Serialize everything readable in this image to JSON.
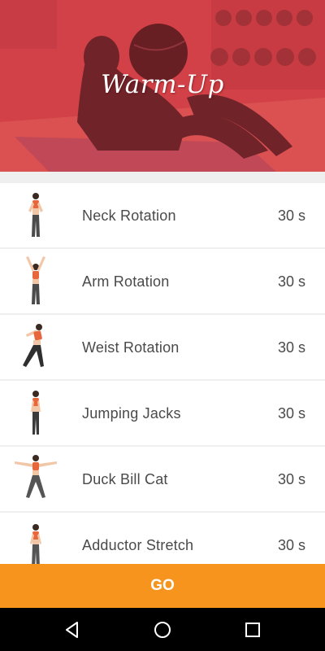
{
  "header": {
    "title": "Warm-Up",
    "overlay_color": "#d8464b"
  },
  "exercises": [
    {
      "name": "Neck Rotation",
      "duration": "30 s",
      "icon": "standing-figure-icon"
    },
    {
      "name": "Arm Rotation",
      "duration": "30 s",
      "icon": "arms-up-figure-icon"
    },
    {
      "name": "Weist Rotation",
      "duration": "30 s",
      "icon": "side-bend-figure-icon"
    },
    {
      "name": "Jumping Jacks",
      "duration": "30 s",
      "icon": "standing-figure-icon"
    },
    {
      "name": "Duck Bill Cat",
      "duration": "30 s",
      "icon": "arms-out-figure-icon"
    },
    {
      "name": "Adductor Stretch",
      "duration": "30 s",
      "icon": "standing-figure-icon"
    }
  ],
  "go_button": {
    "label": "GO",
    "color": "#f7941d"
  },
  "navbar": {
    "back": "back-icon",
    "home": "home-icon",
    "recents": "recents-icon"
  }
}
